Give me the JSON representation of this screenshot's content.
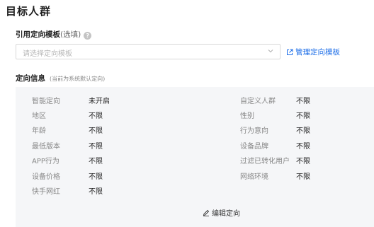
{
  "page": {
    "title": "目标人群"
  },
  "template": {
    "label": "引用定向模板",
    "optional": "(选填)",
    "placeholder": "请选择定向模板",
    "manage_link": "管理定向模板"
  },
  "info": {
    "label": "定向信息",
    "note": "(当前为系统默认定向)",
    "left": [
      {
        "key": "智能定向",
        "value": "未开启"
      },
      {
        "key": "地区",
        "value": "不限"
      },
      {
        "key": "年龄",
        "value": "不限"
      },
      {
        "key": "最低版本",
        "value": "不限"
      },
      {
        "key": "APP行为",
        "value": "不限"
      },
      {
        "key": "设备价格",
        "value": "不限"
      },
      {
        "key": "快手网红",
        "value": "不限"
      }
    ],
    "right": [
      {
        "key": "自定义人群",
        "value": "不限"
      },
      {
        "key": "性别",
        "value": "不限"
      },
      {
        "key": "行为意向",
        "value": "不限"
      },
      {
        "key": "设备品牌",
        "value": "不限"
      },
      {
        "key": "过滤已转化用户",
        "value": "不限"
      },
      {
        "key": "网络环境",
        "value": "不限"
      }
    ],
    "edit_label": "编辑定向"
  }
}
